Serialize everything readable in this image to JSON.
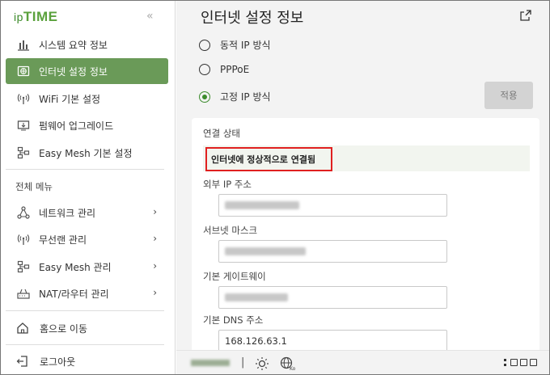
{
  "brand": {
    "logo_prefix": "ip",
    "logo_main": "TIME"
  },
  "sidebar": {
    "collapse_glyph": "«",
    "items": [
      {
        "label": "시스템 요약 정보",
        "icon": "bar-chart-icon"
      },
      {
        "label": "인터넷 설정 정보",
        "icon": "globe-network-icon",
        "active": true
      },
      {
        "label": "WiFi 기본 설정",
        "icon": "wifi-antenna-icon"
      },
      {
        "label": "펌웨어 업그레이드",
        "icon": "firmware-icon"
      },
      {
        "label": "Easy Mesh 기본 설정",
        "icon": "mesh-icon"
      }
    ],
    "section_label": "전체 메뉴",
    "menu_items": [
      {
        "label": "네트워크 관리",
        "icon": "network-icon"
      },
      {
        "label": "무선랜 관리",
        "icon": "wifi-antenna-icon"
      },
      {
        "label": "Easy Mesh 관리",
        "icon": "mesh-icon"
      },
      {
        "label": "NAT/라우터 관리",
        "icon": "router-icon"
      }
    ],
    "home_label": "홈으로 이동",
    "logout_label": "로그아웃",
    "chevron": "›"
  },
  "main": {
    "title": "인터넷 설정 정보",
    "options": [
      {
        "label": "동적 IP 방식",
        "selected": false
      },
      {
        "label": "PPPoE",
        "selected": false
      },
      {
        "label": "고정 IP 방식",
        "selected": true
      }
    ],
    "apply_label": "적용",
    "panel": {
      "status_label": "연결 상태",
      "status_text": "인터넷에 정상적으로 연결됨",
      "external_ip_label": "외부 IP 주소",
      "subnet_label": "서브넷 마스크",
      "gateway_label": "기본 게이트웨이",
      "dns_label": "기본 DNS 주소",
      "dns_value": "168.126.63.1"
    }
  },
  "bottombar": {
    "separator": "|"
  },
  "colors": {
    "accent": "#6a9a58",
    "brand": "#5aa13c",
    "radio_on": "#3d8c2e",
    "highlight": "#e02020"
  }
}
